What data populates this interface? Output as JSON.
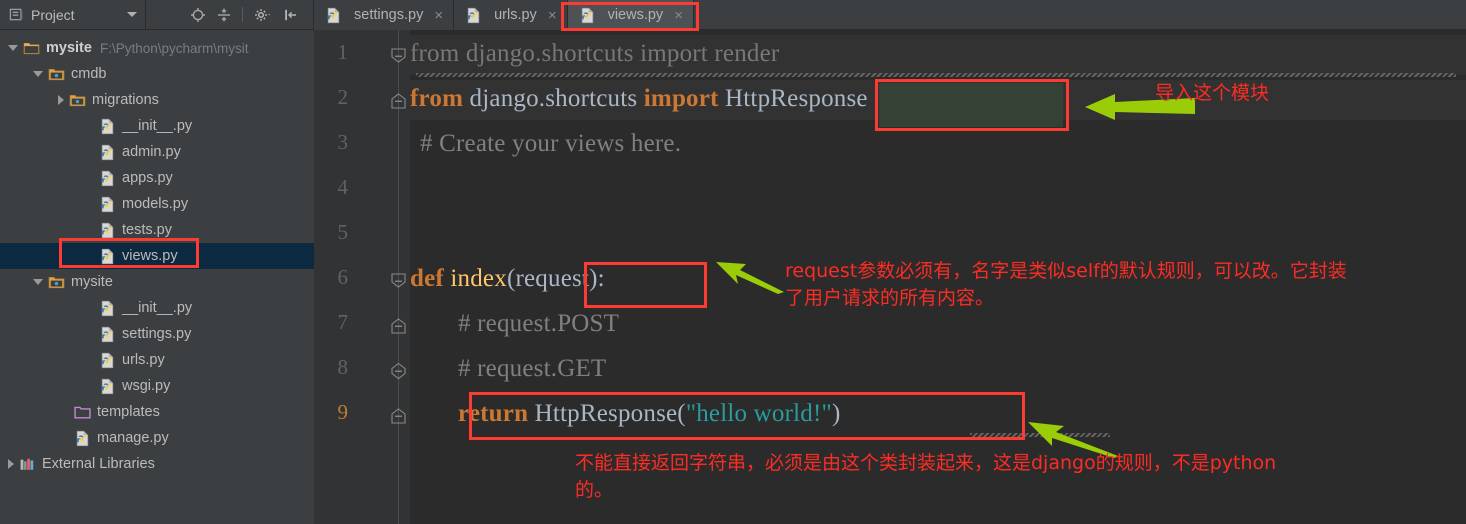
{
  "window": {
    "app": "PyCharm",
    "theme_bg": "#2b2b2b",
    "panel_bg": "#3c3f41",
    "accent_red": "#fc3b33",
    "accent_green": "#9acd08",
    "anno_red": "#fc2c24"
  },
  "project_panel": {
    "tab_label": "Project",
    "tab_icon": "project-view-icon",
    "caret_icon": "chevron-down-icon",
    "toolbar": [
      {
        "name": "scroll-from-source-icon",
        "title": "Select Opened File"
      },
      {
        "name": "collapse-all-icon",
        "title": "Collapse All"
      },
      {
        "name": "gear-icon",
        "title": "Settings"
      },
      {
        "name": "hide-panel-icon",
        "title": "Hide"
      }
    ],
    "tree": [
      {
        "label": "mysite",
        "path": "F:\\Python\\pycharm\\mysit",
        "icon": "folder-module-icon",
        "indent": 0,
        "toggle": "down",
        "bold": true,
        "selected": false
      },
      {
        "label": "cmdb",
        "path": "",
        "icon": "folder-source-icon",
        "indent": 1,
        "toggle": "down",
        "bold": false,
        "selected": false
      },
      {
        "label": "migrations",
        "path": "",
        "icon": "folder-source-icon",
        "indent": 2,
        "toggle": "right",
        "bold": false,
        "selected": false
      },
      {
        "label": "__init__.py",
        "path": "",
        "icon": "python-file-icon",
        "indent": 3,
        "toggle": "none",
        "bold": false,
        "selected": false
      },
      {
        "label": "admin.py",
        "path": "",
        "icon": "python-file-icon",
        "indent": 3,
        "toggle": "none",
        "bold": false,
        "selected": false
      },
      {
        "label": "apps.py",
        "path": "",
        "icon": "python-file-icon",
        "indent": 3,
        "toggle": "none",
        "bold": false,
        "selected": false
      },
      {
        "label": "models.py",
        "path": "",
        "icon": "python-file-icon",
        "indent": 3,
        "toggle": "none",
        "bold": false,
        "selected": false
      },
      {
        "label": "tests.py",
        "path": "",
        "icon": "python-file-icon",
        "indent": 3,
        "toggle": "none",
        "bold": false,
        "selected": false
      },
      {
        "label": "views.py",
        "path": "",
        "icon": "python-file-icon",
        "indent": 3,
        "toggle": "none",
        "bold": false,
        "selected": true
      },
      {
        "label": "mysite",
        "path": "",
        "icon": "folder-source-icon",
        "indent": 1,
        "toggle": "down",
        "bold": false,
        "selected": false
      },
      {
        "label": "__init__.py",
        "path": "",
        "icon": "python-file-icon",
        "indent": 3,
        "toggle": "none",
        "bold": false,
        "selected": false
      },
      {
        "label": "settings.py",
        "path": "",
        "icon": "python-file-icon",
        "indent": 3,
        "toggle": "none",
        "bold": false,
        "selected": false
      },
      {
        "label": "urls.py",
        "path": "",
        "icon": "python-file-icon",
        "indent": 3,
        "toggle": "none",
        "bold": false,
        "selected": false
      },
      {
        "label": "wsgi.py",
        "path": "",
        "icon": "python-file-icon",
        "indent": 3,
        "toggle": "none",
        "bold": false,
        "selected": false
      },
      {
        "label": "templates",
        "path": "",
        "icon": "folder-templates-icon",
        "indent": 2,
        "toggle": "none",
        "bold": false,
        "selected": false
      },
      {
        "label": "manage.py",
        "path": "",
        "icon": "python-file-icon",
        "indent": 2,
        "toggle": "none",
        "bold": false,
        "selected": false
      },
      {
        "label": "External Libraries",
        "path": "",
        "icon": "libraries-icon",
        "indent": 0,
        "toggle": "right",
        "bold": false,
        "selected": false
      }
    ]
  },
  "editor": {
    "tabs": [
      {
        "label": "settings.py",
        "icon": "python-file-icon",
        "active": false,
        "close": "×"
      },
      {
        "label": "urls.py",
        "icon": "python-file-icon",
        "active": false,
        "close": "×"
      },
      {
        "label": "views.py",
        "icon": "python-file-icon",
        "active": true,
        "close": "×"
      }
    ],
    "line_numbers": [
      "1",
      "2",
      "3",
      "4",
      "5",
      "6",
      "7",
      "8",
      "9"
    ],
    "modified_lines": [
      "9"
    ],
    "code_lines": [
      {
        "n": 1,
        "text": "from django.shortcuts import render",
        "style": "unused-import"
      },
      {
        "n": 2,
        "text": "from django.shortcuts import HttpResponse",
        "style": "import"
      },
      {
        "n": 3,
        "text": "# Create your views here.",
        "style": "comment"
      },
      {
        "n": 4,
        "text": "",
        "style": "blank"
      },
      {
        "n": 5,
        "text": "",
        "style": "blank"
      },
      {
        "n": 6,
        "text": "def index(request):",
        "style": "def"
      },
      {
        "n": 7,
        "text": "    # request.POST",
        "style": "comment"
      },
      {
        "n": 8,
        "text": "    # request.GET",
        "style": "comment"
      },
      {
        "n": 9,
        "text": "    return HttpResponse(\"hello world!\")",
        "style": "return"
      }
    ],
    "tokens": {
      "l1_from": "from",
      "l1_mod": " django.shortcuts ",
      "l1_import": "import",
      "l1_name": " render",
      "l2_from": "from",
      "l2_mod": " django.shortcuts ",
      "l2_import": "import",
      "l2_name": " HttpResponse",
      "l3": "# Create your views here.",
      "l6_def": "def",
      "l6_name": " index",
      "l6_open": "(",
      "l6_param": "request",
      "l6_close": "):",
      "l7": "# request.POST",
      "l8": "# request.GET",
      "l9_return": "return",
      "l9_cls": " HttpResponse",
      "l9_open": "(",
      "l9_str": "\"hello world!\"",
      "l9_close": ")"
    }
  },
  "annotations": [
    {
      "id": "anno-import-module",
      "text": "导入这个模块",
      "arrow": "green-arrow-left",
      "target": "HttpResponse"
    },
    {
      "id": "anno-request-param",
      "text": "request参数必须有，名字是类似self的默认规则，可以改。它封装\n了用户请求的所有内容。",
      "arrow": "green-arrow-upleft",
      "target": "request"
    },
    {
      "id": "anno-return-rule",
      "text": "不能直接返回字符串，必须是由这个类封装起来，这是django的规则，不是python\n的。",
      "arrow": "green-arrow-upleft",
      "target": "return HttpResponse(\"hello world!\")"
    }
  ]
}
